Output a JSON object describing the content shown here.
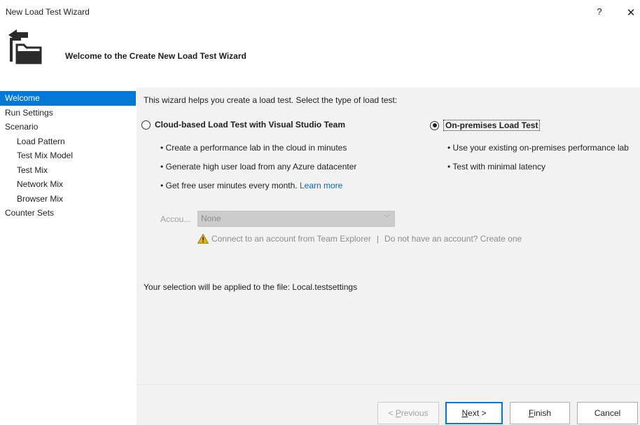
{
  "window": {
    "title": "New Load Test Wizard",
    "help_label": "?",
    "close_label": "✕"
  },
  "header": {
    "title": "Welcome to the Create New Load Test Wizard",
    "icon": "load-test-wizard-icon"
  },
  "sidebar": {
    "items": [
      {
        "label": "Welcome",
        "selected": true,
        "sub": false
      },
      {
        "label": "Run Settings",
        "selected": false,
        "sub": false
      },
      {
        "label": "Scenario",
        "selected": false,
        "sub": false
      },
      {
        "label": "Load Pattern",
        "selected": false,
        "sub": true
      },
      {
        "label": "Test Mix Model",
        "selected": false,
        "sub": true
      },
      {
        "label": "Test Mix",
        "selected": false,
        "sub": true
      },
      {
        "label": "Network Mix",
        "selected": false,
        "sub": true
      },
      {
        "label": "Browser Mix",
        "selected": false,
        "sub": true
      },
      {
        "label": "Counter Sets",
        "selected": false,
        "sub": false
      }
    ]
  },
  "content": {
    "intro": "This wizard helps you create a load test. Select the type of load test:",
    "cloud": {
      "label": "Cloud-based Load Test with Visual Studio Team",
      "selected": false,
      "bullets": [
        "• Create a performance lab in the cloud in minutes",
        "• Generate high user load from any Azure datacenter",
        "• Get free user minutes every month."
      ],
      "learn_more": "Learn more"
    },
    "onprem": {
      "label": "On-premises Load Test",
      "selected": true,
      "bullets": [
        "• Use your existing on-premises performance lab",
        "• Test with minimal latency"
      ]
    },
    "account": {
      "label": "Accou...",
      "value": "None",
      "chevron": "﹀"
    },
    "warning": {
      "connect_text": "Connect to an account from Team Explorer",
      "separator": "|",
      "no_account_text": "Do not have an account? Create one"
    },
    "selection_note": "Your selection will be applied to the file: Local.testsettings"
  },
  "buttons": {
    "previous": "< Previous",
    "next": "Next >",
    "finish": "Finish",
    "cancel": "Cancel"
  }
}
